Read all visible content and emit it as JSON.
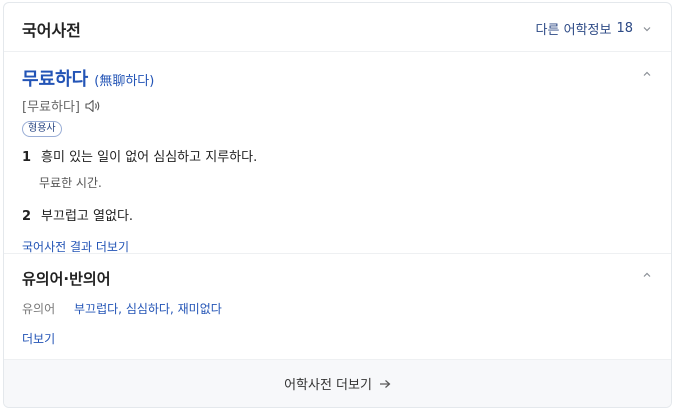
{
  "header": {
    "title": "국어사전",
    "other_info_label": "다른 어학정보",
    "other_info_count": "18"
  },
  "entry": {
    "word": "무료하다",
    "hanja": "(無聊하다)",
    "pronunciation": "[무료하다]",
    "part_of_speech": "형용사",
    "definitions": [
      {
        "num": "1",
        "text": "흥미 있는 일이 없어 심심하고 지루하다.",
        "example": "무료한 시간."
      },
      {
        "num": "2",
        "text": "부끄럽고 열없다."
      }
    ],
    "more_link": "국어사전 결과 더보기"
  },
  "synonyms": {
    "title": "유의어·반의어",
    "label": "유의어",
    "words": [
      "부끄럽다",
      "심심하다",
      "재미없다"
    ],
    "separator": ", ",
    "more_link": "더보기"
  },
  "footer": {
    "label": "어학사전 더보기"
  },
  "icons": {
    "chevron": "chevron-down-icon",
    "collapse": "chevron-up-icon",
    "speaker": "speaker-icon",
    "arrow": "arrow-right-icon"
  },
  "colors": {
    "link": "#2354b6",
    "header_link": "#2d4a86",
    "footer_bg": "#f7f8fa",
    "border": "#e4e8ec"
  }
}
